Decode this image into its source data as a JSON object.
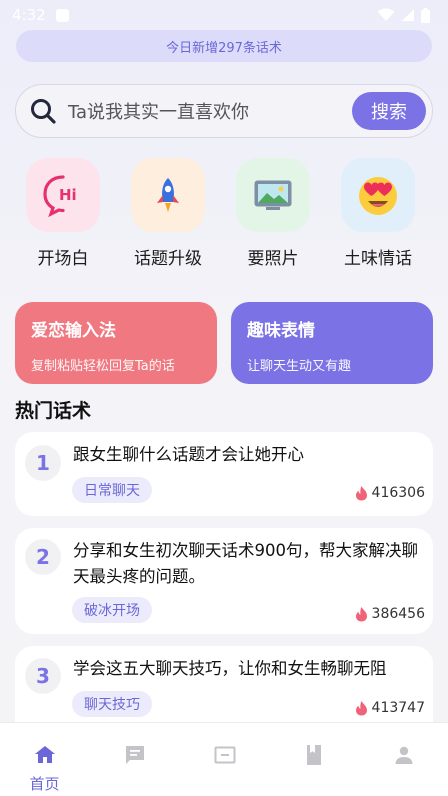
{
  "status_bar": {
    "time": "4:32",
    "icons": [
      "app-notification-icon",
      "wifi-icon",
      "signal-icon",
      "battery-icon"
    ]
  },
  "banner": {
    "text": "今日新增297条话术"
  },
  "search": {
    "placeholder": "Ta说我其实一直喜欢你",
    "button_label": "搜索"
  },
  "features": [
    {
      "label": "开场白",
      "icon": "hi-speech-bubble-icon",
      "bg": "#fde4ec"
    },
    {
      "label": "话题升级",
      "icon": "rocket-icon",
      "bg": "#fdeede"
    },
    {
      "label": "要照片",
      "icon": "photo-icon",
      "bg": "#e3f5e6"
    },
    {
      "label": "土味情话",
      "icon": "heart-eyes-emoji-icon",
      "bg": "#e1effb"
    }
  ],
  "promo_cards": [
    {
      "title": "爱恋输入法",
      "subtitle": "复制粘贴轻松回复Ta的话",
      "color": "#f07880"
    },
    {
      "title": "趣味表情",
      "subtitle": "让聊天生动又有趣",
      "color": "#7b72e6"
    }
  ],
  "hot_section": {
    "title": "热门话术",
    "items": [
      {
        "rank": "1",
        "title": "跟女生聊什么话题才会让她开心",
        "tag": "日常聊天",
        "heat": "416306"
      },
      {
        "rank": "2",
        "title": "分享和女生初次聊天话术900句，帮大家解决聊天最头疼的问题。",
        "tag": "破冰开场",
        "heat": "386456"
      },
      {
        "rank": "3",
        "title": "学会这五大聊天技巧，让你和女生畅聊无阻",
        "tag": "聊天技巧",
        "heat": "413747"
      }
    ]
  },
  "tab_bar": {
    "active_label": "首页",
    "tabs": [
      "home-icon",
      "chat-icon",
      "card-icon",
      "book-icon",
      "profile-icon"
    ],
    "active_color": "#6b67d8",
    "inactive_color": "#c4c4c8"
  }
}
